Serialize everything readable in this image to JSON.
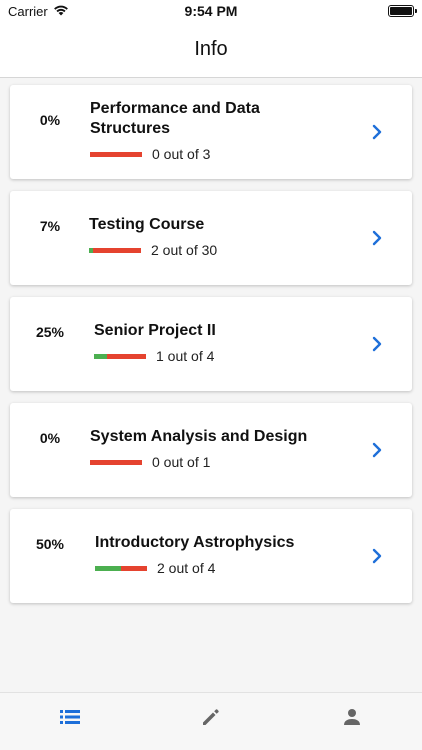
{
  "status_bar": {
    "carrier": "Carrier",
    "time": "9:54 PM"
  },
  "nav": {
    "title": "Info"
  },
  "colors": {
    "accent": "#1e6fd9",
    "progress_complete": "#4caf50",
    "progress_remaining": "#e5432f"
  },
  "courses": [
    {
      "percent": "0%",
      "title_line1": "Performance and Data",
      "title_line2": "Structures",
      "count": "0 out of 3",
      "progress": 0
    },
    {
      "percent": "7%",
      "title_line1": "Testing Course",
      "title_line2": "",
      "count": "2 out of 30",
      "progress": 0.07
    },
    {
      "percent": "25%",
      "title_line1": "Senior Project II",
      "title_line2": "",
      "count": "1 out of 4",
      "progress": 0.25
    },
    {
      "percent": "0%",
      "title_line1": "System Analysis and Design",
      "title_line2": "",
      "count": "0 out of 1",
      "progress": 0
    },
    {
      "percent": "50%",
      "title_line1": "Introductory Astrophysics",
      "title_line2": "",
      "count": "2 out of 4",
      "progress": 0.5
    }
  ],
  "tabs": [
    {
      "icon": "list-icon",
      "active": true
    },
    {
      "icon": "pencil-icon",
      "active": false
    },
    {
      "icon": "person-icon",
      "active": false
    }
  ]
}
